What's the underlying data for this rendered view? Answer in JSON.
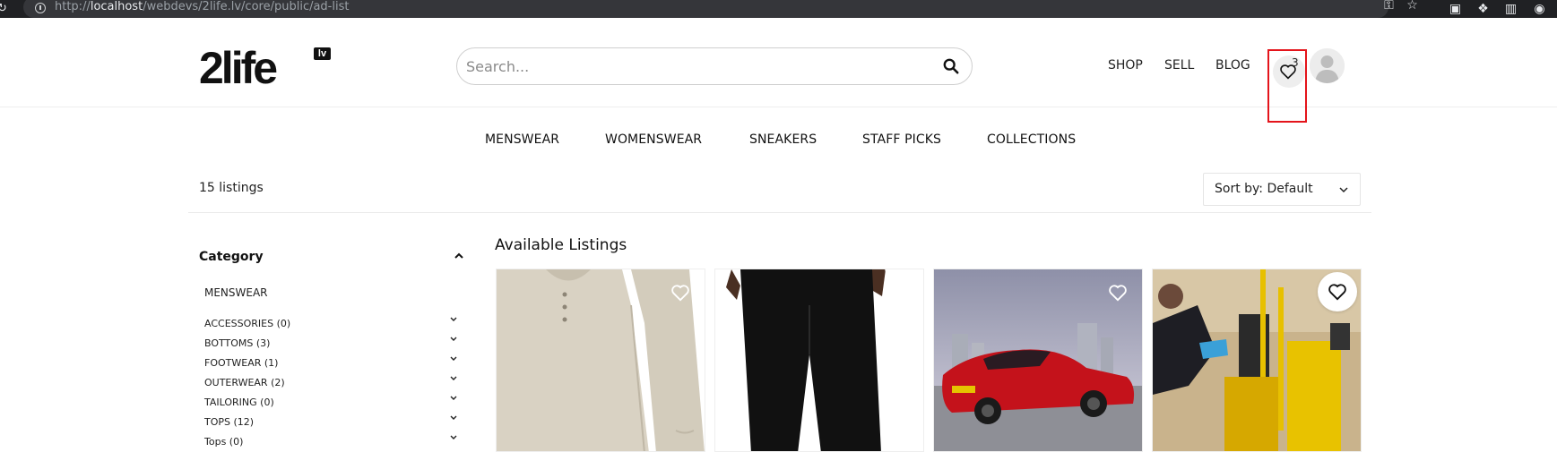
{
  "browser": {
    "url_prefix": "http://",
    "url_host": "localhost",
    "url_path": "/webdevs/2life.lv/core/public/ad-list"
  },
  "header": {
    "logo_text": "2life",
    "logo_badge": "lv",
    "search_placeholder": "Search...",
    "nav": [
      "SHOP",
      "SELL",
      "BLOG"
    ],
    "wishlist_count": "3"
  },
  "category_nav": [
    "MENSWEAR",
    "WOMENSWEAR",
    "SNEAKERS",
    "STAFF PICKS",
    "COLLECTIONS"
  ],
  "toolbar": {
    "listing_count": "15 listings",
    "sort_label": "Sort by: Default"
  },
  "sidebar": {
    "title": "Category",
    "root": "MENSWEAR",
    "items": [
      {
        "label": "ACCESSORIES (0)"
      },
      {
        "label": "BOTTOMS (3)"
      },
      {
        "label": "FOOTWEAR (1)"
      },
      {
        "label": "OUTERWEAR (2)"
      },
      {
        "label": "TAILORING (0)"
      },
      {
        "label": "TOPS (12)"
      },
      {
        "label": "Tops (0)"
      }
    ]
  },
  "listings": {
    "heading": "Available Listings",
    "cards": [
      {
        "subject": "beige henley shirt"
      },
      {
        "subject": "black trousers"
      },
      {
        "subject": "red sports car"
      },
      {
        "subject": "cleaning cart"
      }
    ]
  },
  "colors": {
    "highlight": "#e4141b",
    "browser_bar": "#202124",
    "omnibox": "#35363a"
  }
}
